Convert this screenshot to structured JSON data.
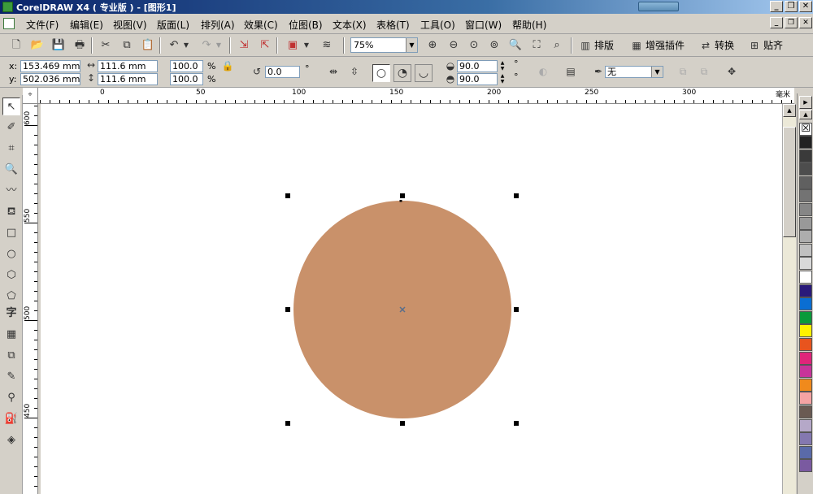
{
  "window": {
    "title": "CorelDRAW X4 ( 专业版 ) - [图形1]",
    "buttons": [
      "_",
      "❐",
      "✕"
    ],
    "doc_buttons": [
      "_",
      "❐",
      "✕"
    ]
  },
  "menu": [
    "文件(F)",
    "编辑(E)",
    "视图(V)",
    "版面(L)",
    "排列(A)",
    "效果(C)",
    "位图(B)",
    "文本(X)",
    "表格(T)",
    "工具(O)",
    "窗口(W)",
    "帮助(H)"
  ],
  "toolbar": {
    "zoom_value": "75%",
    "layout_label": "排版",
    "plugin_label": "增强插件",
    "convert_label": "转换",
    "paste_label": "贴齐"
  },
  "property_bar": {
    "x_label": "x:",
    "y_label": "y:",
    "x_value": "153.469 mm",
    "y_value": "502.036 mm",
    "width_value": "111.6 mm",
    "height_value": "111.6 mm",
    "scale_x": "100.0",
    "scale_y": "100.0",
    "percent": "%",
    "rotation": "0.0",
    "degree": "°",
    "start_angle": "90.0",
    "end_angle": "90.0",
    "outline_value": "无"
  },
  "rulers": {
    "unit": "毫米",
    "h_labels": [
      "0",
      "50",
      "100",
      "150",
      "200",
      "250",
      "300"
    ],
    "v_labels": [
      "600",
      "550",
      "500",
      "450"
    ]
  },
  "shape": {
    "type": "ellipse",
    "fill": "#c9916a"
  },
  "palette_colors": [
    "#222222",
    "#3a3a3a",
    "#4d4d4d",
    "#606060",
    "#737373",
    "#868686",
    "#999999",
    "#adadad",
    "#c0c0c0",
    "#d9d9d9",
    "#ffffff",
    "#2a1a7a",
    "#0a6ed2",
    "#0a9a3a",
    "#fff200",
    "#e8541e",
    "#e0247a",
    "#c8349a",
    "#f08a1c",
    "#f5a3a3",
    "#6a5a52",
    "#b5a8c8",
    "#8478b0",
    "#5a6aa8",
    "#7a5aa0"
  ]
}
